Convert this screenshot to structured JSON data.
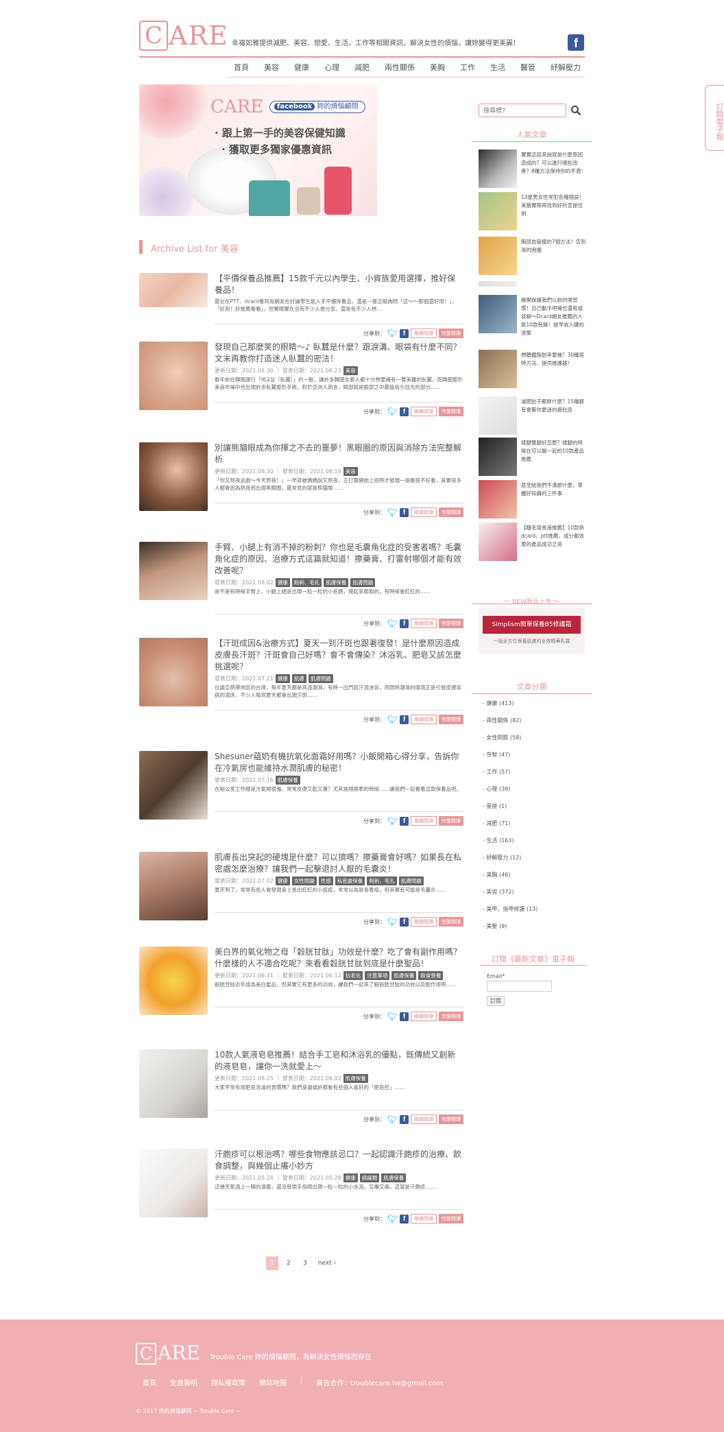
{
  "header": {
    "logo_c": "C",
    "logo_text": "ARE",
    "tagline": "幸福如雅提供減肥、美容、戀愛、生活、工作等相關資訊，解決女性的煩惱，讓妳變得更美麗！",
    "fb": "f",
    "nav": [
      "首頁",
      "美容",
      "健康",
      "心理",
      "減肥",
      "兩性關係",
      "美胸",
      "工作",
      "生活",
      "醫管",
      "紓解壓力"
    ]
  },
  "banner": {
    "care": "CARE",
    "fb_label": "facebook",
    "fb_text": "妳的煩惱顧問",
    "line1": "· 跟上第一手的美容保健知識",
    "line2": "· 獲取更多獨家優惠資訊"
  },
  "archive_title": "Archive List for 美容",
  "share_label": "分享到：",
  "btn_read": "繼續閱讀",
  "btn_more": "完整閱讀",
  "posts": [
    {
      "title": "【平價保養品推薦】15款千元以內學生、小資族愛用選擇，推好保養品！",
      "meta": "",
      "tags": [],
      "excerpt": "最近在PTT、dcard看到有網友在討論學生能入手平價保養品，還是一樣這般詢問「這～～那個還好用！」，「好用！好推薦看看」，但實際實在沒有不少人推分享，還是有不少人想…"
    },
    {
      "title": "發現自己那麼笑的眼睛～♪ 臥蠶是什麼？跟淚溝、眼袋有什麼不同？文末再教你打造迷人臥蠶的密法！",
      "meta": "更新日期：2021.08.30 ｜ 發表日期：2021.08.23",
      "tags": [
        "美容"
      ],
      "excerpt": "藝年前在韓國盛行「애교살（臥蠶）」的一股，讓許多韓國女藝人都十分想要擁有一雙美麗的臥蠶，而韓國整形美容市場中也出現許多臥蠶整形手術。對於亞洲人而言，眼部就是臉部之中最能吸引目光的部分……"
    },
    {
      "title": "別讓熊貓眼成為你揮之不去的噩夢！黑眼圈的原因與消除方法完整解析",
      "meta": "更新日期：2021.08.30 ｜ 發表日期：2021.08.19",
      "tags": [
        "美容"
      ],
      "excerpt": "「你又熬夜追劇～今天熬夜！」一早就被媽媽說又熬夜，正打算開始上班時才發現一張臉很不好看，其實很多人都會因為熬夜而出現黑眼圈，最常見的就是熊貓眼……"
    },
    {
      "title": "手臂、小腿上有消不掉的粉刺？你也是毛囊角化症的受害者嗎？毛囊角化症的原因、治療方式這篇就知道！擦藥膏、打雷射哪個才能有效改善呢？",
      "meta": "發表日期：2021.08.02",
      "tags": [
        "健康",
        "粉刺、毛孔",
        "肌膚保養",
        "肌膚問題"
      ],
      "excerpt": "是不是有時候手臂上、小腿上總是出現一粒一粒的小疙瘩，摸起來粗粗的，有時候會紅紅的……"
    },
    {
      "title": "【汗斑成因&治療方式】夏天一到汗斑也跟著復發！是什麼原因造成皮膚長汗斑？汗斑會自己好嗎？會不會傳染？沐浴乳、肥皂又該怎麼挑選呢？",
      "meta": "發表日期：2021.07.21",
      "tags": [
        "健康",
        "肌膚",
        "肌膚問題"
      ],
      "excerpt": "位處亞熱帶地區的台灣，每年夏天都是高溫潮濕，有時一出門就汗流浹背，而悶熱潮濕的環境正是引發皮膚疾病的溫床，不少人每到夏天都會出現汗斑……"
    },
    {
      "title": "Shesuner蘊奶有機抗氧化面霜好用嗎？小飯開箱心得分享，告訴你在冷氣房也能維持水潤肌膚的秘密！",
      "meta": "發表日期：2021.07.16",
      "tags": [
        "肌膚保養"
      ],
      "excerpt": "在辦公室工作總是冷氣開很強，常常皮膚又乾又癢？尤其是剛換季的時候……讓我們一起看看這款保養品吧。"
    },
    {
      "title": "肌膚長出突起的硬塊是什麼？可以擠嗎？擦藥膏會好嗎？如果長在私密處怎麼治療？讓我們一起擊退討人厭的毛囊炎！",
      "meta": "發表日期：2021.07.02",
      "tags": [
        "健康",
        "女性問題",
        "性感",
        "私密處保養",
        "粉刺、毛孔",
        "肌膚問題"
      ],
      "excerpt": "夏天到了，常常有些人會發現身上長出紅紅的小痘痘，常常以為是青春痘，但其實有可能是毛囊炎……"
    },
    {
      "title": "美白界的氧化物之母「穀胱甘肽」功效是什麼？吃了會有副作用嗎？什麼樣的人不適合吃呢？來看看穀胱甘肽到底是什麼聖品！",
      "meta": "更新日期：2021.06.11 ｜ 發表日期：2021.06.12",
      "tags": [
        "抗老化",
        "注意事項",
        "肌膚保養",
        "飲食營養"
      ],
      "excerpt": "穀胱甘肽近年成為美白聖品，但其實它有更多的功效，讓我們一起來了解穀胱甘肽的功效以及副作用吧……"
    },
    {
      "title": "10款人氣液皂皂推薦！結合手工皂和沐浴乳的優點，既傳統又創新的液皂皂，讓你一洗就愛上～",
      "meta": "更新日期：2021.08.25 ｜ 發表日期：2021.06.02",
      "tags": [
        "肌膚保養"
      ],
      "excerpt": "大家平常有用肥皂洗澡的習慣嗎？我們身邊或許都會有些個人喜好的「肥皂控」……"
    },
    {
      "title": "汗皰疹可以根治嗎？哪些食物應該忌口？一起認識汗皰疹的治療、飲食調整，與幾個止癢小妙方",
      "meta": "更新日期：2021.05.26 ｜ 發表日期：2021.05.28",
      "tags": [
        "健康",
        "病痛類",
        "肌膚保養"
      ],
      "excerpt": "這幾天氣溫上一陣的溫暖，還沒發現手指間出現一粒一粒的小水泡，又癢又痛，這就是汗皰疹……"
    }
  ],
  "sidebar": {
    "search_placeholder": "搜尋標?",
    "popular_title": "人氣文章",
    "popular": [
      {
        "t": "寶寶這屈來說就是什麼原因造成的？可以進行哪些改善？8種方法保持你的不適！"
      },
      {
        "t": "13星男女性常犯各種錯誤！美貌實際再找到好的宣提佳例"
      },
      {
        "t": "胸部血管瘤的7個方法！告別濕的困擾"
      },
      {
        "t": ""
      },
      {
        "t": "擁開保護我們以前的壞習慣！自己動手吧擁也還有或就解～Dcard網友推薦的人氣10款有解！提早收入罐的達案"
      },
      {
        "t": "想聽體脂肪率要幾？30種居時方法、提供維護器！"
      },
      {
        "t": "減肥肚子都胖什麼？15種都有會幫你更迷的瘦肚皮"
      },
      {
        "t": "揉腿雙腿好怎麼？揉腿的時候在可以解一起的10款產品推薦"
      },
      {
        "t": "甚至給我們不滿那什麼，掌握好知識的三件事"
      },
      {
        "t": "【睫毛增長液推薦】10款熱dcard、ptt推薦，成分都效果的產品成功之道"
      }
    ],
    "new_label": "～ NEW新品上市 ～",
    "new_inner": "Simplism簡單保養B5修護霜",
    "new_caption": "一瓶全方位保養肌膚的全效精華乳霜",
    "cat_title": "文章分類",
    "categories": [
      "- 健康 (413)",
      "- 兩性關係 (82)",
      "- 女性問題 (58)",
      "- 奈智 (47)",
      "- 工作 (57)",
      "- 心理 (39)",
      "- 星座 (1)",
      "- 減肥 (71)",
      "- 生活 (163)",
      "- 紓解壓力 (12)",
      "- 美胸 (46)",
      "- 美容 (372)",
      "- 美甲、指甲修護 (13)",
      "- 美髮 (9)"
    ],
    "sub_title": "訂閱《最新文章》電子報",
    "email_label": "Email*",
    "sub_btn": "訂閱",
    "side_tab": "訂閱電子報"
  },
  "pager": {
    "pages": [
      "1",
      "2",
      "3"
    ],
    "next": "next ›"
  },
  "footer": {
    "logo_c": "C",
    "logo": "ARE",
    "tagline": "Trouble Care 妳的煩惱顧問，為解決女性煩惱而存在",
    "links": [
      "首頁",
      "免責聲明",
      "隱私權政策",
      "網站地圖"
    ],
    "contact": "廣告合作：troublecare.tw@gmail.com",
    "copyright": "© 2017 妳的煩惱顧問 ~ Trouble Care ~"
  },
  "colors": {
    "accent": "#e8959a",
    "footer": "#f0b0b3",
    "fb": "#3b5998",
    "twitter": "#1da1f2"
  }
}
